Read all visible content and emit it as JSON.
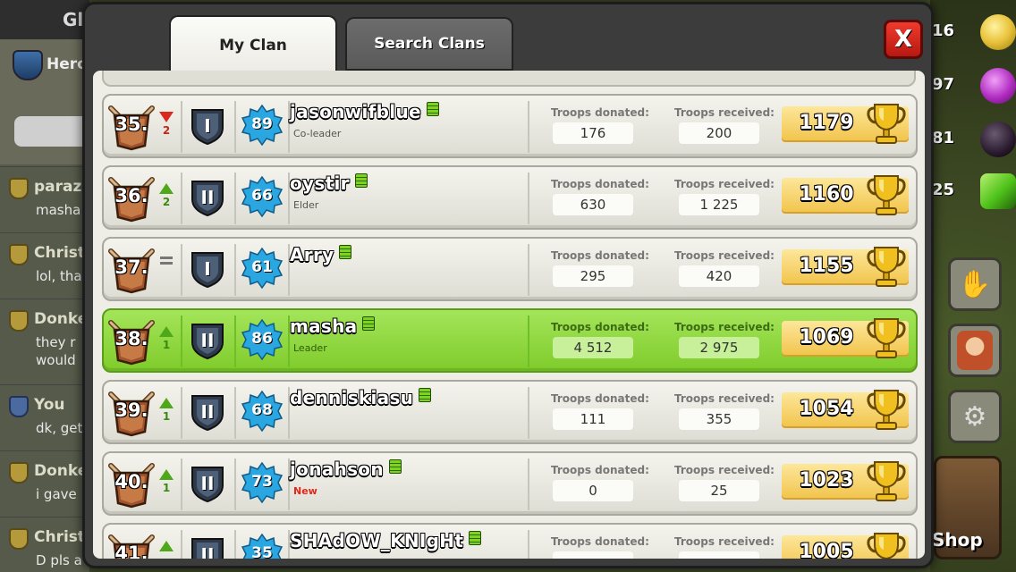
{
  "background": {
    "left_tab_label": "Gl",
    "clan_name": "Hero",
    "chat": [
      {
        "name": "paraz",
        "message": "masha",
        "badge": "gold"
      },
      {
        "name": "Christ",
        "message": "lol, tha",
        "badge": "gold"
      },
      {
        "name": "Donke",
        "message": "they r\nwould",
        "badge": "gold"
      },
      {
        "name": "You",
        "message": "dk, get",
        "badge": "blue"
      },
      {
        "name": "Donke",
        "message": "i gave",
        "badge": "gold"
      },
      {
        "name": "Christ",
        "message": "D pls a",
        "badge": "gold"
      }
    ],
    "resources": [
      {
        "value": "16",
        "icon": "gold-coin-icon",
        "color": "#e8c23a"
      },
      {
        "value": "97",
        "icon": "elixir-drop-icon",
        "color": "#b02cc0"
      },
      {
        "value": "81",
        "icon": "dark-elixir-icon",
        "color": "#2a1a2e"
      },
      {
        "value": "25",
        "icon": "gem-icon",
        "color": "#4fc21a"
      }
    ],
    "shop_label": "Shop"
  },
  "dialog": {
    "tabs": [
      {
        "label": "My Clan",
        "active": true
      },
      {
        "label": "Search Clans",
        "active": false
      }
    ],
    "close_label": "X",
    "donated_label": "Troops donated:",
    "received_label": "Troops received:",
    "members": [
      {
        "rank": "35.",
        "trend": "down",
        "delta": "2",
        "league": "I",
        "level": "89",
        "name": "jasonwifblue",
        "role": "Co-leader",
        "donated": "176",
        "received": "200",
        "trophies": "1179"
      },
      {
        "rank": "36.",
        "trend": "up",
        "delta": "2",
        "league": "II",
        "level": "66",
        "name": "oystir",
        "role": "Elder",
        "donated": "630",
        "received": "1 225",
        "trophies": "1160"
      },
      {
        "rank": "37.",
        "trend": "same",
        "delta": "",
        "league": "I",
        "level": "61",
        "name": "Arry",
        "role": "",
        "donated": "295",
        "received": "420",
        "trophies": "1155"
      },
      {
        "rank": "38.",
        "trend": "up",
        "delta": "1",
        "league": "II",
        "level": "86",
        "name": "masha",
        "role": "Leader",
        "donated": "4 512",
        "received": "2 975",
        "trophies": "1069",
        "highlight": true
      },
      {
        "rank": "39.",
        "trend": "up",
        "delta": "1",
        "league": "II",
        "level": "68",
        "name": "denniskiasu",
        "role": "",
        "donated": "111",
        "received": "355",
        "trophies": "1054"
      },
      {
        "rank": "40.",
        "trend": "up",
        "delta": "1",
        "league": "II",
        "level": "73",
        "name": "jonahson",
        "role": "New",
        "donated": "0",
        "received": "25",
        "trophies": "1023"
      },
      {
        "rank": "41.",
        "trend": "up",
        "delta": "",
        "league": "II",
        "level": "35",
        "name": "SHAdOW_KNIgHt",
        "role": "",
        "donated": "",
        "received": "",
        "trophies": "1005"
      }
    ],
    "colors": {
      "leader_row": "#8fd63a",
      "normal_row": "#ecebe3",
      "trophy_box": "#f6d56b",
      "level_star": "#2aa6e0",
      "league_shield": "#3c4c60",
      "close_button": "#d9261a"
    }
  }
}
